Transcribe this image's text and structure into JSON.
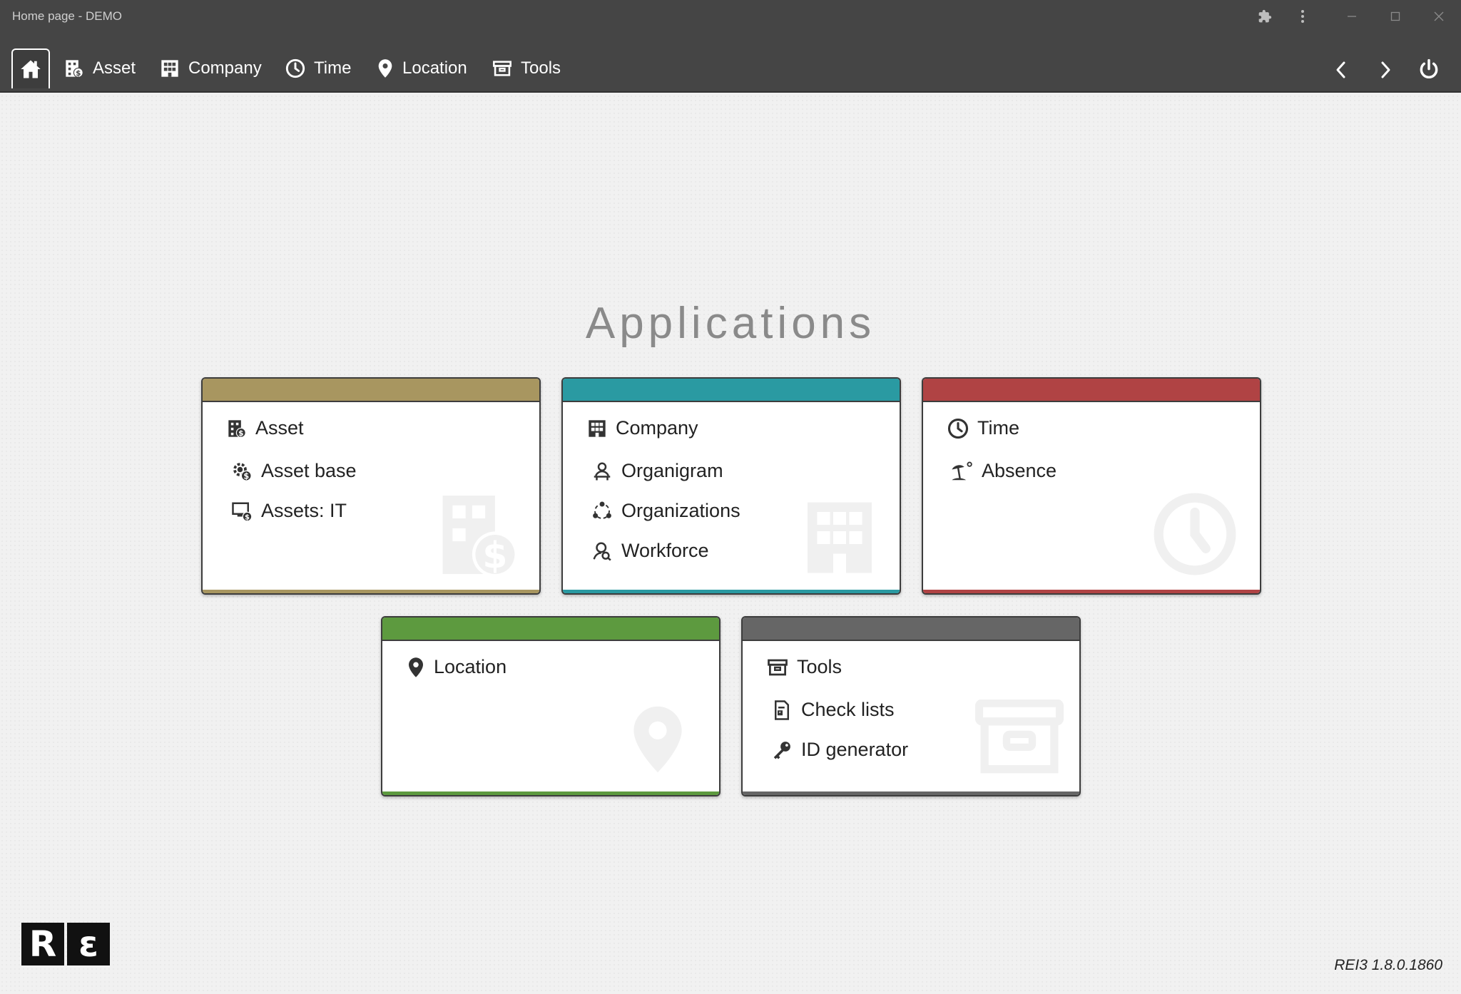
{
  "window": {
    "title": "Home page - DEMO"
  },
  "menu": {
    "items": [
      {
        "label": "Asset",
        "icon": "asset-icon"
      },
      {
        "label": "Company",
        "icon": "building-icon"
      },
      {
        "label": "Time",
        "icon": "clock-icon"
      },
      {
        "label": "Location",
        "icon": "map-pin-icon"
      },
      {
        "label": "Tools",
        "icon": "archive-box-icon"
      }
    ]
  },
  "heading": "Applications",
  "cards": [
    {
      "color": "#a89660",
      "items": [
        "Asset",
        "Asset base",
        "Assets: IT"
      ]
    },
    {
      "color": "#2a9aa2",
      "items": [
        "Company",
        "Organigram",
        "Organizations",
        "Workforce"
      ]
    },
    {
      "color": "#b04344",
      "items": [
        "Time",
        "Absence"
      ]
    },
    {
      "color": "#5d9a3f",
      "items": [
        "Location"
      ]
    },
    {
      "color": "#666666",
      "items": [
        "Tools",
        "Check lists",
        "ID generator"
      ]
    }
  ],
  "footer": {
    "logo_left": "R",
    "logo_right": "ɛ",
    "version": "REI3 1.8.0.1860"
  }
}
